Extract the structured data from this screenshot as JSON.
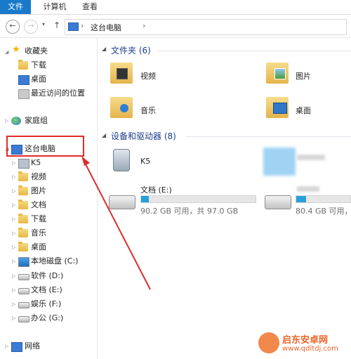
{
  "ribbon": {
    "tabs": [
      "文件",
      "计算机",
      "查看"
    ]
  },
  "address": {
    "path": "这台电脑",
    "sep": "›"
  },
  "nav": {
    "favorites": "收藏夹",
    "fav_items": [
      "下载",
      "桌面",
      "最近访问的位置"
    ],
    "homegroup": "家庭组",
    "thispc": "这台电脑",
    "pc_items": [
      "K5",
      "视频",
      "图片",
      "文档",
      "下载",
      "音乐",
      "桌面",
      "本地磁盘 (C:)",
      "软件 (D:)",
      "文档 (E:)",
      "娱乐 (F:)",
      "办公 (G:)"
    ],
    "network": "网络"
  },
  "main": {
    "folders_title": "文件夹 (6)",
    "folders": [
      "视频",
      "图片",
      "音乐",
      "桌面"
    ],
    "devices_title": "设备和驱动器 (8)",
    "devices": {
      "k5": "K5",
      "drive_e_label": "文档 (E:)",
      "drive_e_cap": "90.2 GB 可用，共 97.0 GB",
      "drive_e_fill": 0.07,
      "drive_2_cap": "80.4 GB 可用，共",
      "drive_2_fill": 0.18
    }
  },
  "watermark": {
    "name": "启东安卓网",
    "url": "www.qdltdj.com"
  },
  "colors": {
    "accent": "#1979ca",
    "highlight": "#e02b2b",
    "bar": "#26a0da"
  }
}
